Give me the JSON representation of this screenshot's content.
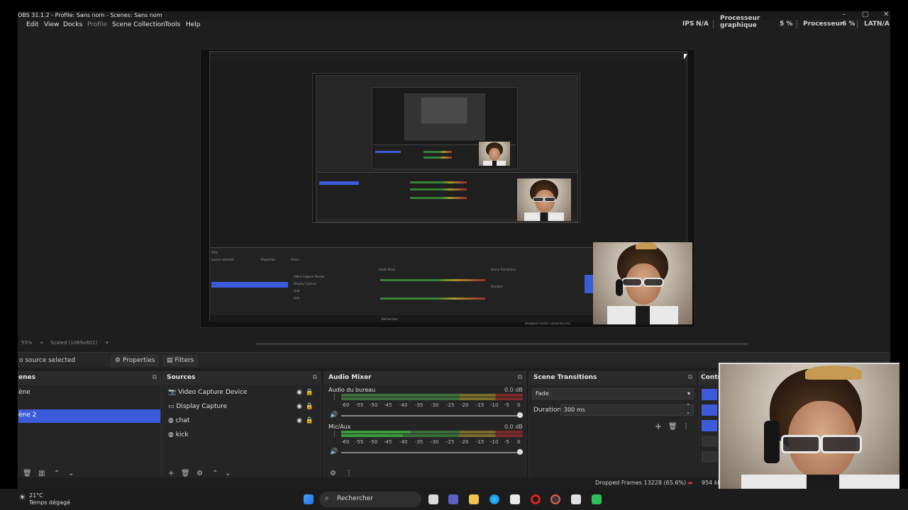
{
  "window": {
    "title": "OBS 31.1.2 - Profile: Sans nom - Scenes: Sans nom",
    "controls": {
      "minimize": "–",
      "maximize": "▢",
      "close": "✕"
    }
  },
  "menu": [
    "Edit",
    "View",
    "Docks",
    "Profile",
    "Scene Collection",
    "Tools",
    "Help"
  ],
  "stats": {
    "fps_label": "IPS",
    "fps_value": "N/A",
    "gpu_label": "Processeur graphique",
    "gpu_value": "5 %",
    "cpu_label": "Processeur",
    "cpu_value": "6 %",
    "lat_label": "LAT",
    "lat_value": "N/A"
  },
  "preview": {
    "zoom": "55%",
    "scale": "Scaled (1069x601)",
    "mini_taskbar_search": "Rechercher",
    "mini_dropped": "Dropped Frames 13228 (65.6%)"
  },
  "toolbar": {
    "no_source": "o source selected",
    "properties": "Properties",
    "filters": "Filters"
  },
  "scenes": {
    "title": "enes",
    "items": [
      "ène",
      "ène 2"
    ],
    "selected_index": 1
  },
  "sources": {
    "title": "Sources",
    "items": [
      {
        "label": "Video Capture Device",
        "icon": "camera-icon"
      },
      {
        "label": "Display Capture",
        "icon": "monitor-icon"
      },
      {
        "label": "chat",
        "icon": "browser-icon"
      },
      {
        "label": "kick",
        "icon": "browser-icon"
      }
    ]
  },
  "audio": {
    "title": "Audio Mixer",
    "tracks": [
      {
        "name": "Audio du bureau",
        "db": "0.0 dB"
      },
      {
        "name": "Mic/Aux",
        "db": "0.0 dB"
      }
    ],
    "ticks": [
      "-60",
      "-55",
      "-50",
      "-45",
      "-40",
      "-35",
      "-30",
      "-25",
      "-20",
      "-15",
      "-10",
      "-5",
      "0"
    ]
  },
  "transitions": {
    "title": "Scene Transitions",
    "type": "Fade",
    "duration_label": "Duration",
    "duration_value": "300 ms"
  },
  "controls": {
    "title": "Contr"
  },
  "status": {
    "dropped": "Dropped Frames 13228 (65.6%)",
    "bitrate": "954 kb"
  },
  "taskbar": {
    "weather_temp": "21°C",
    "weather_text": "Temps dégagé",
    "search": "Rechercher"
  },
  "colors": {
    "accent": "#3b5bdb",
    "meter_green": "#3c9b3c",
    "meter_yellow": "#c7b52a",
    "meter_red": "#b33333"
  }
}
